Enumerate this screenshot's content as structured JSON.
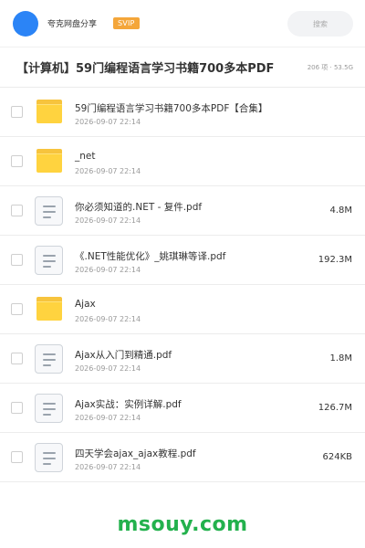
{
  "header": {
    "app_name": "夸克网盘分享",
    "vip_badge": "SVIP",
    "search_placeholder": "搜索"
  },
  "folder": {
    "title": "【计算机】59门编程语言学习书籍700多本PDF",
    "meta": "206 项 · 53.5G"
  },
  "files": [
    {
      "type": "folder",
      "name": "59门编程语言学习书籍700多本PDF【合集】",
      "date": "2026-09-07 22:14",
      "size": ""
    },
    {
      "type": "folder",
      "name": "_net",
      "date": "2026-09-07 22:14",
      "size": ""
    },
    {
      "type": "file",
      "name": "你必须知道的.NET - 复件.pdf",
      "date": "2026-09-07 22:14",
      "size": "4.8M"
    },
    {
      "type": "file",
      "name": "《.NET性能优化》_姚琪琳等译.pdf",
      "date": "2026-09-07 22:14",
      "size": "192.3M"
    },
    {
      "type": "folder",
      "name": "Ajax",
      "date": "2026-09-07 22:14",
      "size": ""
    },
    {
      "type": "file",
      "name": "Ajax从入门到精通.pdf",
      "date": "2026-09-07 22:14",
      "size": "1.8M"
    },
    {
      "type": "file",
      "name": "Ajax实战：实例详解.pdf",
      "date": "2026-09-07 22:14",
      "size": "126.7M"
    },
    {
      "type": "file",
      "name": "四天学会ajax_ajax教程.pdf",
      "date": "2026-09-07 22:14",
      "size": "624KB"
    }
  ],
  "watermark": "msouy.com",
  "colors": {
    "avatar": "#2b84f6",
    "vip_badge": "#f4a63a",
    "folder_icon": "#ffd33f",
    "watermark": "#23b14d"
  },
  "icons": {
    "folder": "folder-icon",
    "file": "pdf-file-icon"
  }
}
